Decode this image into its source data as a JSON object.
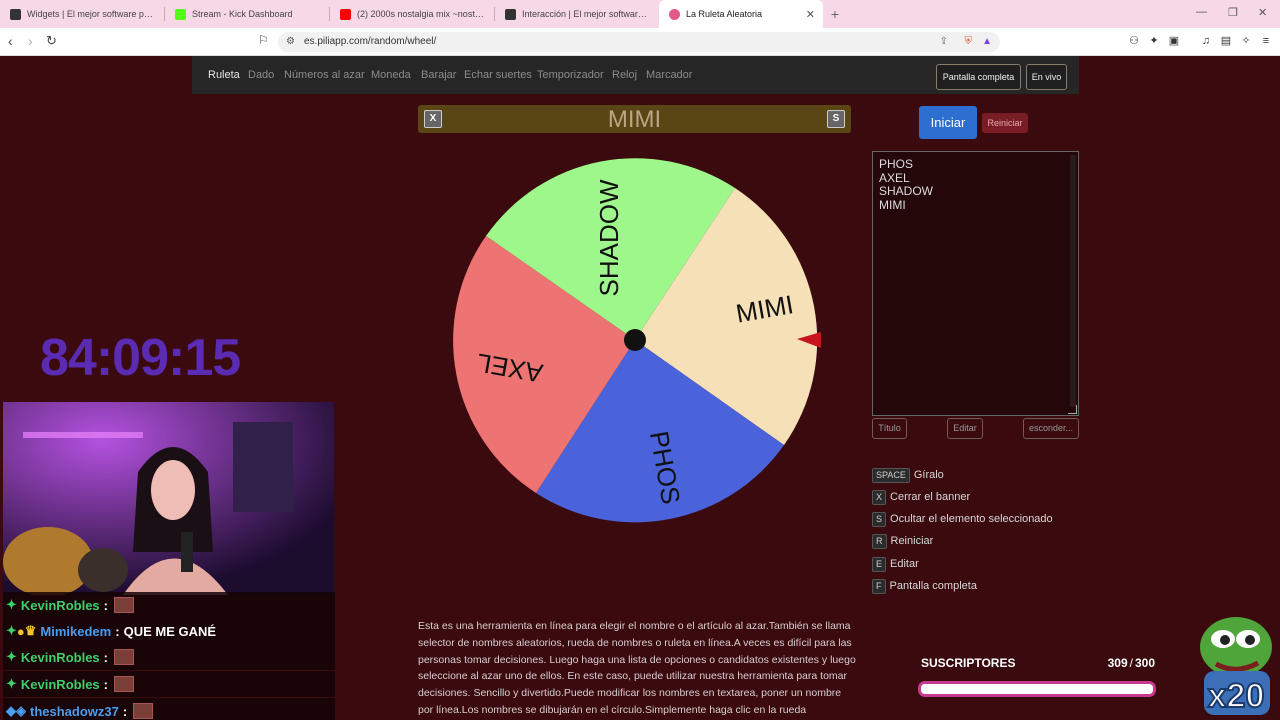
{
  "browser": {
    "tabs": [
      {
        "title": "Widgets | El mejor software para pod",
        "color": "#333"
      },
      {
        "title": "Stream - Kick Dashboard",
        "color": "#53fc18"
      },
      {
        "title": "(2) 2000s nostalgia mix ~nostalg",
        "color": "#ff0000"
      },
      {
        "title": "Interacción | El mejor software para",
        "color": "#333"
      },
      {
        "title": "La Ruleta Aleatoria",
        "color": "#e25a8a",
        "active": true
      }
    ],
    "url": "es.piliapp.com/random/wheel/"
  },
  "site": {
    "nav": [
      "Ruleta",
      "Dado",
      "Números al azar",
      "Moneda",
      "Barajar",
      "Echar suertes",
      "Temporizador",
      "Reloj",
      "Marcador"
    ],
    "fullscreen_label": "Pantalla completa",
    "live_label": "En vivo"
  },
  "banner": {
    "close_key": "X",
    "hide_key": "S",
    "title": "MIMI"
  },
  "wheel": {
    "segments": [
      {
        "label": "SHADOW",
        "color": "#9ef78a"
      },
      {
        "label": "MIMI",
        "color": "#f6e0b8"
      },
      {
        "label": "PHOS",
        "color": "#4a63da"
      },
      {
        "label": "AXEL",
        "color": "#ee7373"
      }
    ]
  },
  "controls": {
    "start_label": "Iniciar",
    "reset_label": "Reiniciar",
    "names": [
      "PHOS",
      "AXEL",
      "SHADOW",
      "MIMI"
    ],
    "title_btn": "Título",
    "edit_btn": "Editar",
    "hide_btn": "esconder..."
  },
  "shortcuts": [
    {
      "key": "SPACE",
      "label": "Gíralo"
    },
    {
      "key": "X",
      "label": "Cerrar el banner"
    },
    {
      "key": "S",
      "label": "Ocultar el elemento seleccionado"
    },
    {
      "key": "R",
      "label": "Reiniciar"
    },
    {
      "key": "E",
      "label": "Editar"
    },
    {
      "key": "F",
      "label": "Pantalla completa"
    }
  ],
  "description": "Esta es una herramienta en línea para elegir el nombre o el artículo al azar.También se llama selector de nombres aleatorios, rueda de nombres o ruleta en línea.A veces es difícil para las personas tomar decisiones. Luego haga una lista de opciones o candidatos existentes y luego seleccione al azar uno de ellos. En este caso, puede utilizar nuestra herramienta para tomar decisiones. Sencillo y divertido.Puede modificar los nombres en textarea, poner un nombre por línea.Los nombres se dibujarán en el círculo.Simplemente haga clic en la rueda",
  "overlay": {
    "timer": "84:09:15",
    "chat": [
      {
        "user": "KevinRobles",
        "sep": ":",
        "msg": "",
        "emote": true,
        "color": "green"
      },
      {
        "user": "Mimikedem",
        "sep": ":",
        "msg": "QUE ME GANÉ",
        "emote": false,
        "color": "blue"
      },
      {
        "user": "KevinRobles",
        "sep": ":",
        "msg": "",
        "emote": true,
        "color": "green"
      },
      {
        "user": "KevinRobles",
        "sep": ":",
        "msg": "",
        "emote": true,
        "color": "green"
      },
      {
        "user": "theshadowz37",
        "sep": ":",
        "msg": "",
        "emote": true,
        "color": "blue"
      }
    ],
    "subs_label": "SUSCRIPTORES",
    "subs_current": "309",
    "subs_sep": "/",
    "subs_goal": "300",
    "subs_progress": 1.0,
    "sticker_text": "x20"
  }
}
